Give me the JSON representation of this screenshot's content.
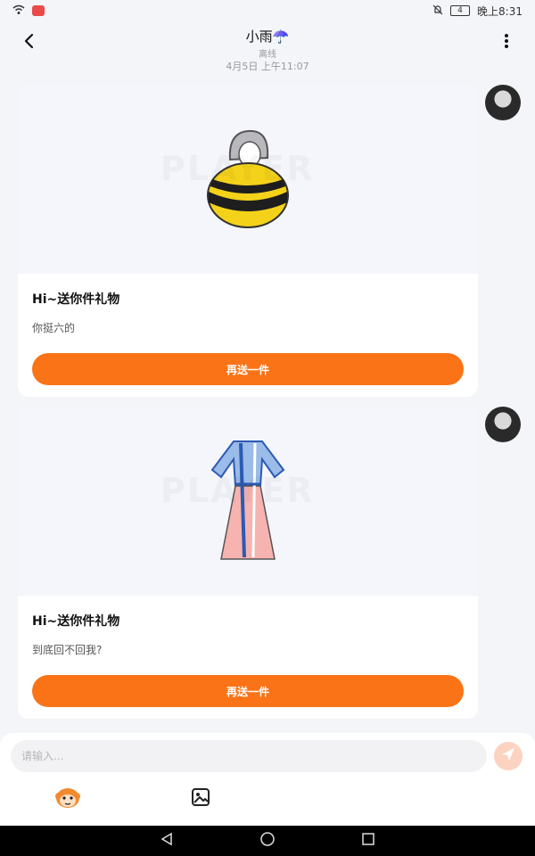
{
  "status_bar": {
    "time": "晚上8:31",
    "battery_level": "4",
    "icons": [
      "wifi-icon",
      "app-notification-icon",
      "mute-icon",
      "battery-icon"
    ]
  },
  "header": {
    "contact_name": "小雨☂️",
    "contact_status": "离线",
    "icons": [
      "back-arrow-icon",
      "more-vertical-icon"
    ]
  },
  "chat": {
    "timestamp": "4月5日 上午11:07",
    "messages": [
      {
        "title": "Hi~送你件礼物",
        "text": "你挺六的",
        "button_label": "再送一件",
        "gift": "bee-costume-icon"
      },
      {
        "title": "Hi~送你件礼物",
        "text": "到底回不回我?",
        "button_label": "再送一件",
        "gift": "hanfu-dress-icon"
      }
    ]
  },
  "input_bar": {
    "placeholder": "请输入...",
    "icons": [
      "send-icon",
      "emoji-monkey-icon",
      "image-icon"
    ]
  },
  "nav_bar": {
    "icons": [
      "nav-back-icon",
      "nav-home-icon",
      "nav-recents-icon"
    ]
  },
  "colors": {
    "accent": "#fa7317",
    "background": "#f4f5f9",
    "send_disabled": "#fcd3c0"
  }
}
